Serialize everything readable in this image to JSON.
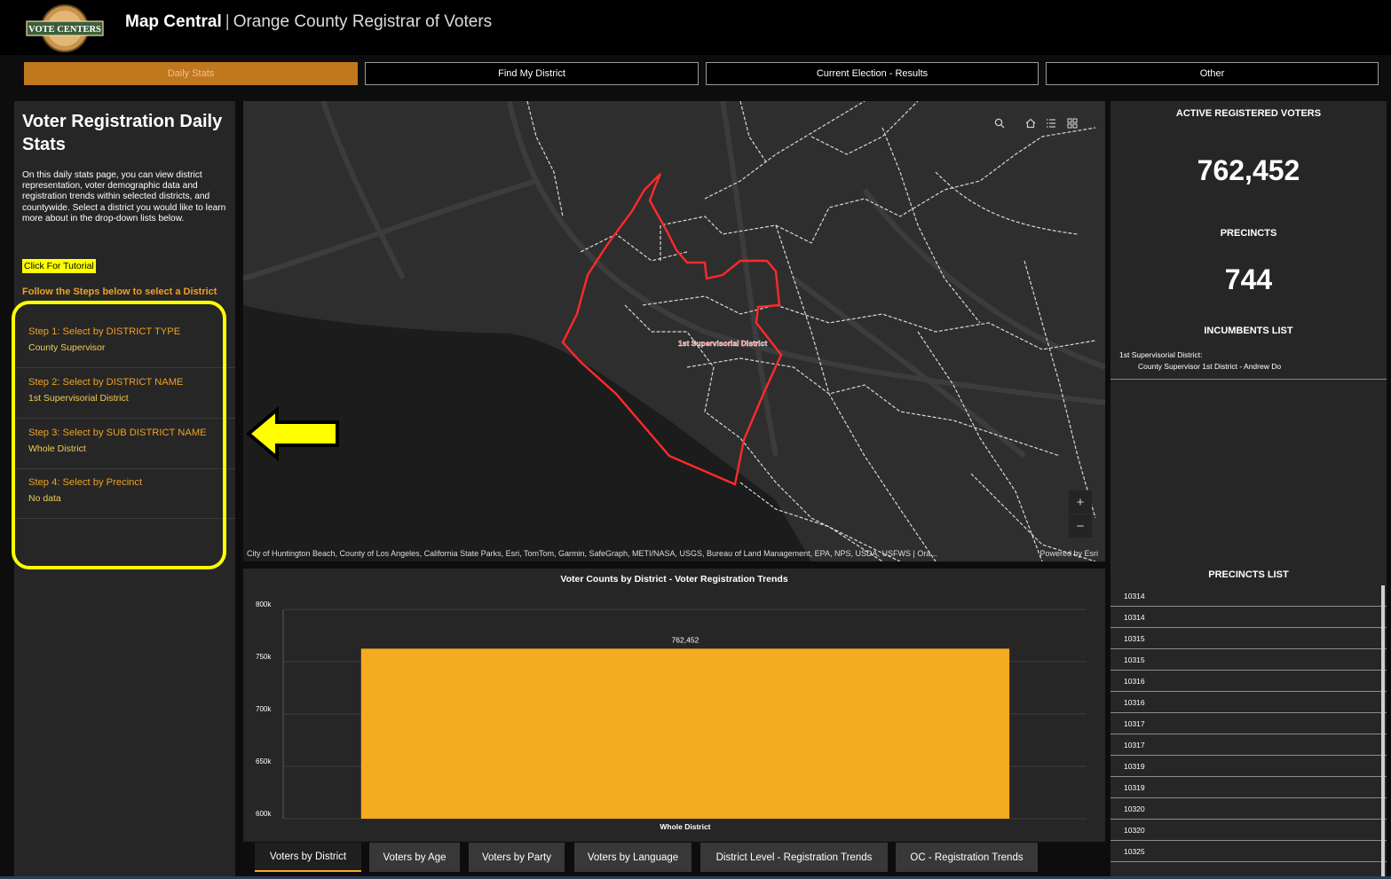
{
  "header": {
    "logo_text": "VOTE CENTERS",
    "title_bold": "Map Central",
    "separator": "|",
    "title_rest": "Orange County Registrar of Voters"
  },
  "nav": {
    "tabs": [
      {
        "label": "Daily Stats",
        "active": true
      },
      {
        "label": "Find My District",
        "active": false
      },
      {
        "label": "Current Election - Results",
        "active": false
      },
      {
        "label": "Other",
        "active": false
      }
    ]
  },
  "left_panel": {
    "title": "Voter Registration Daily Stats",
    "description": "On this daily stats page, you can view district representation, voter demographic data and registration trends within selected districts, and countywide. Select a district you would like to learn more about in the drop-down lists below.",
    "tutorial_button": "Click For Tutorial",
    "follow_text": "Follow the Steps below to select a District",
    "steps": [
      {
        "label": "Step 1: Select by DISTRICT TYPE",
        "value": "County Supervisor"
      },
      {
        "label": "Step 2: Select by DISTRICT NAME",
        "value": "1st Supervisorial District"
      },
      {
        "label": "Step 3: Select by SUB DISTRICT NAME",
        "value": "Whole District"
      },
      {
        "label": "Step 4: Select by Precinct",
        "value": "No data"
      }
    ]
  },
  "map": {
    "district_label": "1st Supervisorial District",
    "attribution": "City of Huntington Beach, County of Los Angeles, California State Parks, Esri, TomTom, Garmin, SafeGraph, METI/NASA, USGS, Bureau of Land Management, EPA, NPS, USDA, USFWS | Ora...",
    "powered_by": "Powered by Esri",
    "zoom_in": "+",
    "zoom_out": "−"
  },
  "chart": {
    "title": "Voter Counts by District - Voter Registration Trends"
  },
  "chart_data": {
    "type": "bar",
    "title": "Voter Counts by District - Voter Registration Trends",
    "categories": [
      "Whole District"
    ],
    "values": [
      762452
    ],
    "value_labels": [
      "762,452"
    ],
    "y_ticks": [
      "600k",
      "650k",
      "700k",
      "750k",
      "800k"
    ],
    "ylim": [
      600000,
      800000
    ],
    "xlabel": "",
    "ylabel": "",
    "bar_color": "#f5ab20",
    "grid": true
  },
  "bottom_tabs": [
    {
      "label": "Voters by District",
      "active": true
    },
    {
      "label": "Voters by Age",
      "active": false
    },
    {
      "label": "Voters by Party",
      "active": false
    },
    {
      "label": "Voters by Language",
      "active": false
    },
    {
      "label": "District Level - Registration Trends",
      "active": false
    },
    {
      "label": "OC - Registration Trends",
      "active": false
    }
  ],
  "right_panel": {
    "active_voters_title": "ACTIVE REGISTERED VOTERS",
    "active_voters_value": "762,452",
    "precincts_title": "PRECINCTS",
    "precincts_value": "744",
    "incumbents_title": "INCUMBENTS LIST",
    "incumbent_district": "1st Supervisorial District:",
    "incumbent_name": "County Supervisor 1st District - Andrew Do",
    "precincts_list_title": "PRECINCTS LIST",
    "precincts_list": [
      "10314",
      "10314",
      "10315",
      "10315",
      "10316",
      "10316",
      "10317",
      "10317",
      "10319",
      "10319",
      "10320",
      "10320",
      "10325"
    ]
  },
  "colors": {
    "accent": "#f5ab20",
    "active_tab": "#c0781f",
    "district_outline": "#ff2a2a",
    "highlight": "#ffff00"
  }
}
